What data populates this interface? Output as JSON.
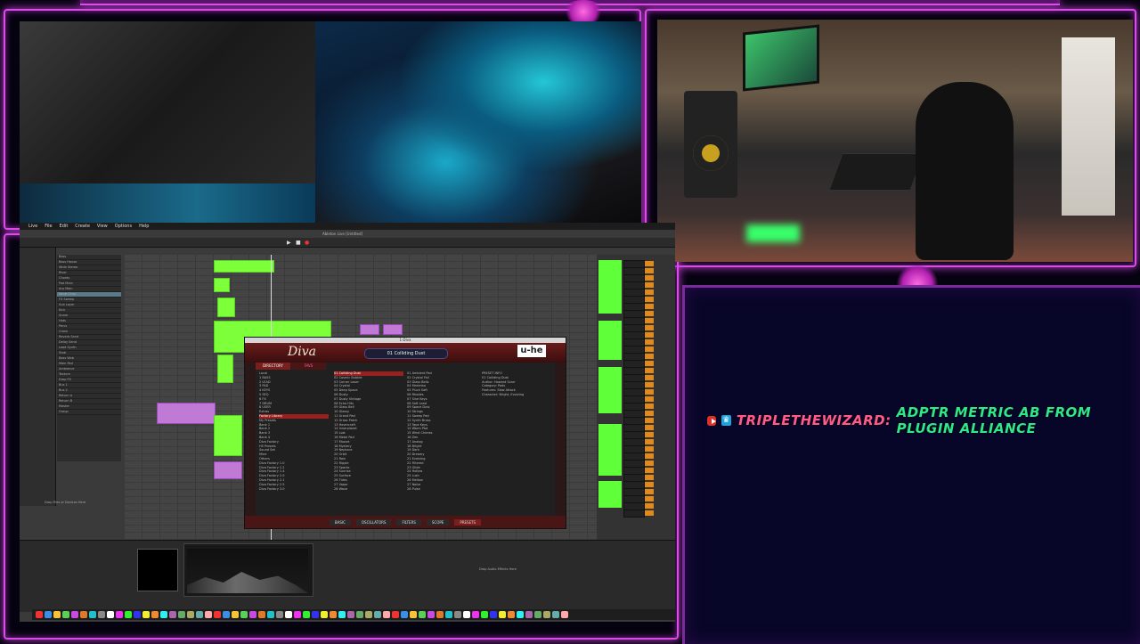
{
  "stream": {
    "chat": {
      "user": "TRIPLETHEWIZARD:",
      "message": "ADPTR METRIC AB FROM PLUGIN ALLIANCE"
    }
  },
  "daw": {
    "menu": [
      "Live",
      "File",
      "Edit",
      "Create",
      "View",
      "Options",
      "Help"
    ],
    "title": "Ableton Live [Untitled]",
    "tracks": [
      "Bass",
      "Bass House",
      "Wide Stereo",
      "Riser",
      "Chords",
      "Pad Main",
      "Arp Main",
      "Vocal Chop",
      "FX Sweep",
      "Sub Layer",
      "Kick",
      "Snare",
      "Hats",
      "Percs",
      "Crash",
      "Reverb Send",
      "Delay Send",
      "Lead Synth",
      "Stab",
      "Bass Wob",
      "Main Pad",
      "Ambience",
      "Texture",
      "Drop FX",
      "Bus 1",
      "Bus 2",
      "Return A",
      "Return B",
      "Master",
      "Group"
    ],
    "mix_tracks": [
      "1 Kick",
      "2 Snare",
      "3 Hats",
      "4 Bass",
      "5 Pad",
      "6 Lead",
      "7 FX",
      "8 Vox"
    ],
    "bottom_text": "Drop Audio Effects Here",
    "drop_text": "Drop Files or Devices Here"
  },
  "diva": {
    "window_title": "1-Diva",
    "logo": "Diva",
    "preset": "01 Colliding Dust",
    "brand": "u-he",
    "tabs": [
      "DIRECTORY",
      "FAVS"
    ],
    "directory": [
      "Local",
      "1 BASS",
      "2 LEAD",
      "3 PAD",
      "4 KEYS",
      "5 SEQ",
      "6 FX",
      "7 DRUM",
      "8 USER",
      "Extras",
      "Factory Library",
      "My Presets",
      "Bank 1",
      "Bank 2",
      "Bank 3",
      "Bank 4",
      "Diva Factory",
      "HS Presets",
      "Sound Set",
      "Mine",
      "Others",
      "Diva Factory 1.0",
      "Diva Factory 1.2",
      "Diva Factory 1.4",
      "Diva Factory 2.0",
      "Diva Factory 2.1",
      "Diva Factory 2.5",
      "Diva Factory 3.0"
    ],
    "presets_a": [
      "01 Colliding Dust",
      "02 Cosmic Bubble",
      "03 Corner Laser",
      "04 Crystal",
      "05 Deep Space",
      "06 Dusty",
      "07 Dusty Vintage",
      "08 Echo Hits",
      "09 Glass Bell",
      "10 Glassy",
      "11 Grand Pad",
      "12 Grass Patch",
      "13 Hovercraft",
      "14 Innerplanet",
      "15 Lost",
      "16 Metal Pad",
      "17 Mozart",
      "18 Mystery",
      "19 Neptune",
      "20 Orbit",
      "21 Rain",
      "22 Ripple",
      "23 Sparks",
      "24 Sunrise",
      "25 Surface",
      "26 Tides",
      "27 Vapor",
      "28 Wave"
    ],
    "presets_b": [
      "01 Ambient Pad",
      "02 Crystal Fall",
      "03 Glass Bells",
      "04 Marimba",
      "05 Pluck Soft",
      "06 Rhodes",
      "07 Sine Keys",
      "08 Soft Lead",
      "09 Space Dust",
      "10 Strings",
      "11 Sweep Pad",
      "12 Synth Brass",
      "13 Tape Keys",
      "14 Warm Pad",
      "15 Wind Chimes",
      "16 Zen",
      "17 Analog",
      "18 Bright",
      "19 Dark",
      "20 Dreamy",
      "21 Evolving",
      "22 Filtered",
      "23 Glide",
      "24 Hollow",
      "25 Lush",
      "26 Mellow",
      "27 Noise",
      "28 Pulse"
    ],
    "info": [
      "PRESET INFO",
      "01 Colliding Dust",
      "Author: Howard Scarr",
      "Category: Pads",
      "Features: Slow Attack",
      "Character: Bright, Evolving"
    ],
    "footer": [
      "BASIC",
      "OSCILLATORS",
      "FILTERS",
      "SCOPE",
      "PRESETS"
    ]
  },
  "colors": {
    "neon": "#d84fe6",
    "clip_green": "#7dff3a",
    "clip_purple": "#c07ad6",
    "diva_red": "#7a1e1e",
    "chat_user": "#ff5a8a",
    "chat_msg": "#2ee88a"
  }
}
